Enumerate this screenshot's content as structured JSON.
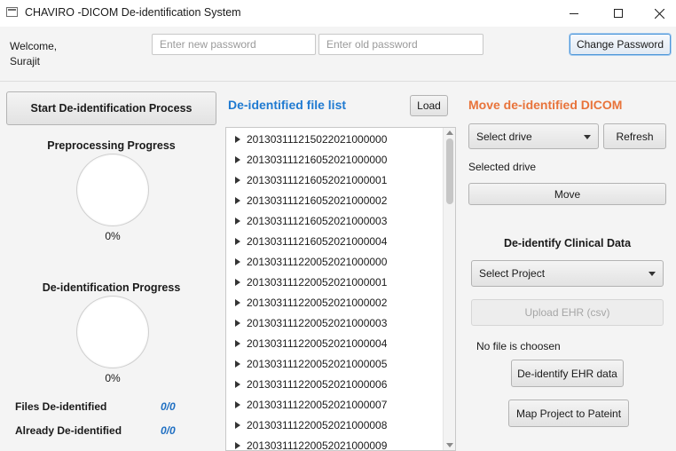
{
  "window": {
    "title": "CHAVIRO -DICOM De-identification System",
    "controls": [
      "minimize",
      "maximize",
      "close"
    ]
  },
  "header": {
    "welcome_line1": "Welcome,",
    "welcome_line2": "Surajit",
    "new_password_placeholder": "Enter new password",
    "old_password_placeholder": "Enter old password",
    "change_password_label": "Change Password"
  },
  "left_panel": {
    "start_button_label": "Start De-identification Process",
    "preprocessing_label": "Preprocessing Progress",
    "preprocessing_value": "0%",
    "deidentification_label": "De-identification Progress",
    "deidentification_value": "0%",
    "files_deidentified_label": "Files De-identified",
    "files_deidentified_value": "0/0",
    "already_deidentified_label": "Already De-identified",
    "already_deidentified_value": "0/0"
  },
  "file_list": {
    "title": "De-identified file list",
    "load_label": "Load",
    "items": [
      "201303111215022021000000",
      "201303111216052021000000",
      "201303111216052021000001",
      "201303111216052021000002",
      "201303111216052021000003",
      "201303111216052021000004",
      "201303111220052021000000",
      "201303111220052021000001",
      "201303111220052021000002",
      "201303111220052021000003",
      "201303111220052021000004",
      "201303111220052021000005",
      "201303111220052021000006",
      "201303111220052021000007",
      "201303111220052021000008",
      "201303111220052021000009"
    ]
  },
  "right_panel": {
    "move_title": "Move de-identified DICOM",
    "select_drive_label": "Select drive",
    "refresh_label": "Refresh",
    "selected_drive_label": "Selected drive",
    "move_label": "Move",
    "clinical_title": "De-identify Clinical Data",
    "select_project_label": "Select Project",
    "upload_label": "Upload EHR (csv)",
    "no_file_label": "No file is choosen",
    "deidentify_ehr_label": "De-identify EHR data",
    "map_project_label": "Map Project to Pateint"
  },
  "colors": {
    "accent_blue": "#1f7ad1",
    "accent_orange": "#e8733a",
    "focus_border": "#4d96d8"
  }
}
